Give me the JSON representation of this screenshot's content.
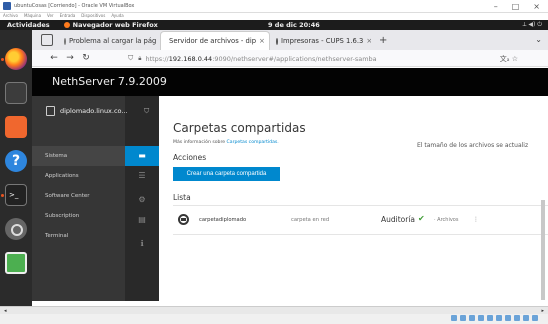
{
  "vbox": {
    "title": "ubuntuCosas [Corriendo] - Oracle VM VirtualBox",
    "menu": [
      "Archivo",
      "Máquina",
      "Ver",
      "Entrada",
      "Dispositivos",
      "Ayuda"
    ],
    "controls": [
      "–",
      "□",
      "×"
    ]
  },
  "gnome": {
    "activities": "Actividades",
    "app": "Navegador web Firefox",
    "clock": "9 de dic  20:46"
  },
  "browser": {
    "tabs": [
      {
        "label": "Problema al cargar la pág"
      },
      {
        "label": "Servidor de archivos - dip"
      },
      {
        "label": "Impresoras - CUPS 1.6.3"
      }
    ],
    "new_tab": "+",
    "url_host": "192.168.0.44",
    "url_prefix": "https://",
    "url_path": ":9090/nethserver#/applications/nethserver-samba"
  },
  "ns": {
    "product": "NethServer 7.9.2009",
    "host": "diplomado.linux.co...",
    "nav": [
      "Sistema",
      "Applications",
      "Software Center",
      "Subscription",
      "Terminal"
    ],
    "title": "Carpetas compartidas",
    "more_prefix": "Más información sobre",
    "more_link": "Carpetas compartidas.",
    "size_note": "El tamaño de los archivos se actualiz",
    "actions": "Acciones",
    "create_button": "Crear una carpeta compartida",
    "list": "Lista",
    "rows": [
      {
        "name": "carpetadiplomado",
        "description": "carpeta en red",
        "audit": "Auditoría",
        "archive": "· Archivos",
        "menu": "⋮"
      }
    ]
  }
}
